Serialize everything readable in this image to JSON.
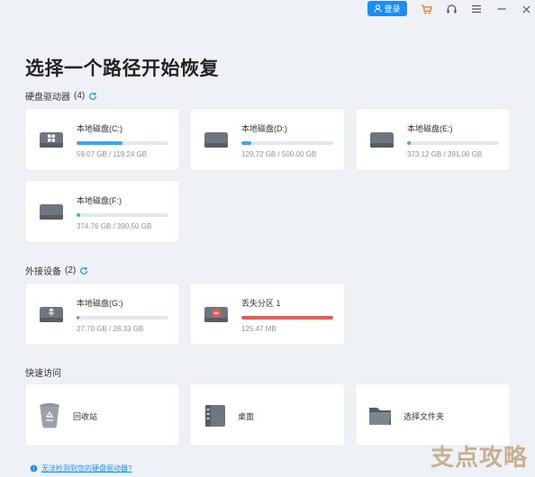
{
  "topbar": {
    "login_label": "登录"
  },
  "title": "选择一个路径开始恢复",
  "hard_drives": {
    "label": "硬盘驱动器",
    "count": "(4)",
    "items": [
      {
        "name": "本地磁盘(C:)",
        "size": "59.07 GB / 119.24 GB",
        "usage": 0.5,
        "icon": "windows-drive-icon"
      },
      {
        "name": "本地磁盘(D:)",
        "size": "129.72 GB / 500.00 GB",
        "usage": 0.11,
        "icon": "drive-icon"
      },
      {
        "name": "本地磁盘(E:)",
        "size": "373.12 GB / 391.00 GB",
        "usage": 0.04,
        "icon": "drive-icon"
      },
      {
        "name": "本地磁盘(F:)",
        "size": "374.76 GB / 390.50 GB",
        "usage": 0.04,
        "icon": "drive-icon"
      }
    ]
  },
  "external_devices": {
    "label": "外接设备",
    "count": "(2)",
    "items": [
      {
        "name": "本地磁盘(G:)",
        "size": "27.70 GB / 28.33 GB",
        "usage": 0.03,
        "icon": "usb-drive-icon"
      },
      {
        "name": "丢失分区 1",
        "size": "125.47 MB",
        "usage": 1.0,
        "icon": "lost-partition-icon"
      }
    ]
  },
  "quick_access": {
    "label": "快速访问",
    "items": [
      {
        "label": "回收站",
        "icon": "recycle-bin-icon"
      },
      {
        "label": "桌面",
        "icon": "desktop-icon"
      },
      {
        "label": "选择文件夹",
        "icon": "folder-icon"
      }
    ]
  },
  "footer": {
    "link": "无法检测到您的硬盘驱动器?"
  },
  "watermark": "支点攻略",
  "colors": {
    "accent": "#1a8cff",
    "usage_bar": "#3aa5f2",
    "lost_bar": "#ee5a52",
    "background": "#eef2f6"
  }
}
